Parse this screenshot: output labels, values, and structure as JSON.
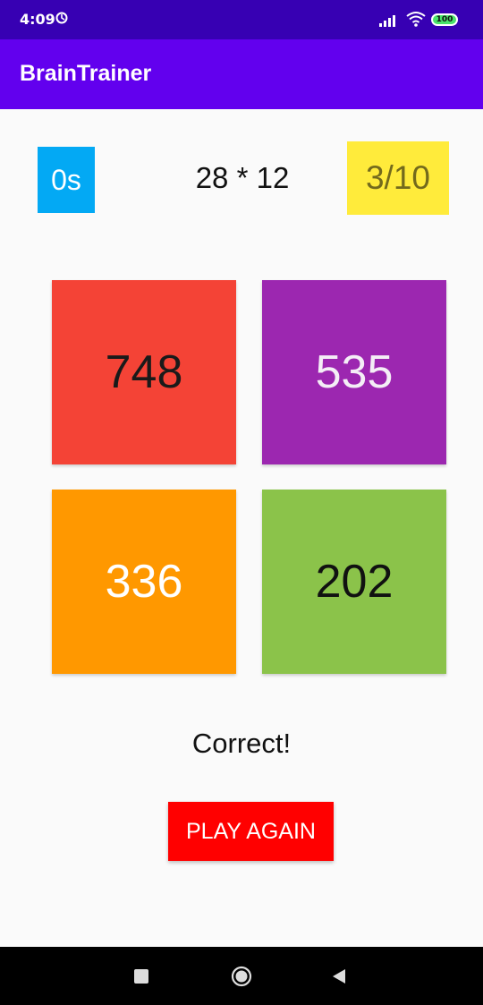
{
  "status_bar": {
    "time": "4:09",
    "battery": "100",
    "icons": [
      "sync-icon",
      "signal-icon",
      "wifi-icon",
      "battery-icon"
    ]
  },
  "app_bar": {
    "title": "BrainTrainer"
  },
  "game": {
    "timer": "0s",
    "question": "28 * 12",
    "score": "3/10",
    "answers": [
      "748",
      "535",
      "336",
      "202"
    ],
    "result": "Correct!",
    "play_again_label": "PLAY AGAIN"
  },
  "nav_bar": {
    "icons": [
      "recent-apps-icon",
      "home-icon",
      "back-icon"
    ]
  },
  "colors": {
    "status_bar": "#3700b3",
    "app_bar": "#6200ee",
    "timer_bg": "#03a9f4",
    "score_bg": "#ffeb3b",
    "answer_red": "#f44336",
    "answer_purple": "#9c27b0",
    "answer_orange": "#ff9800",
    "answer_green": "#8bc34a",
    "play_again_bg": "#ff0000"
  }
}
